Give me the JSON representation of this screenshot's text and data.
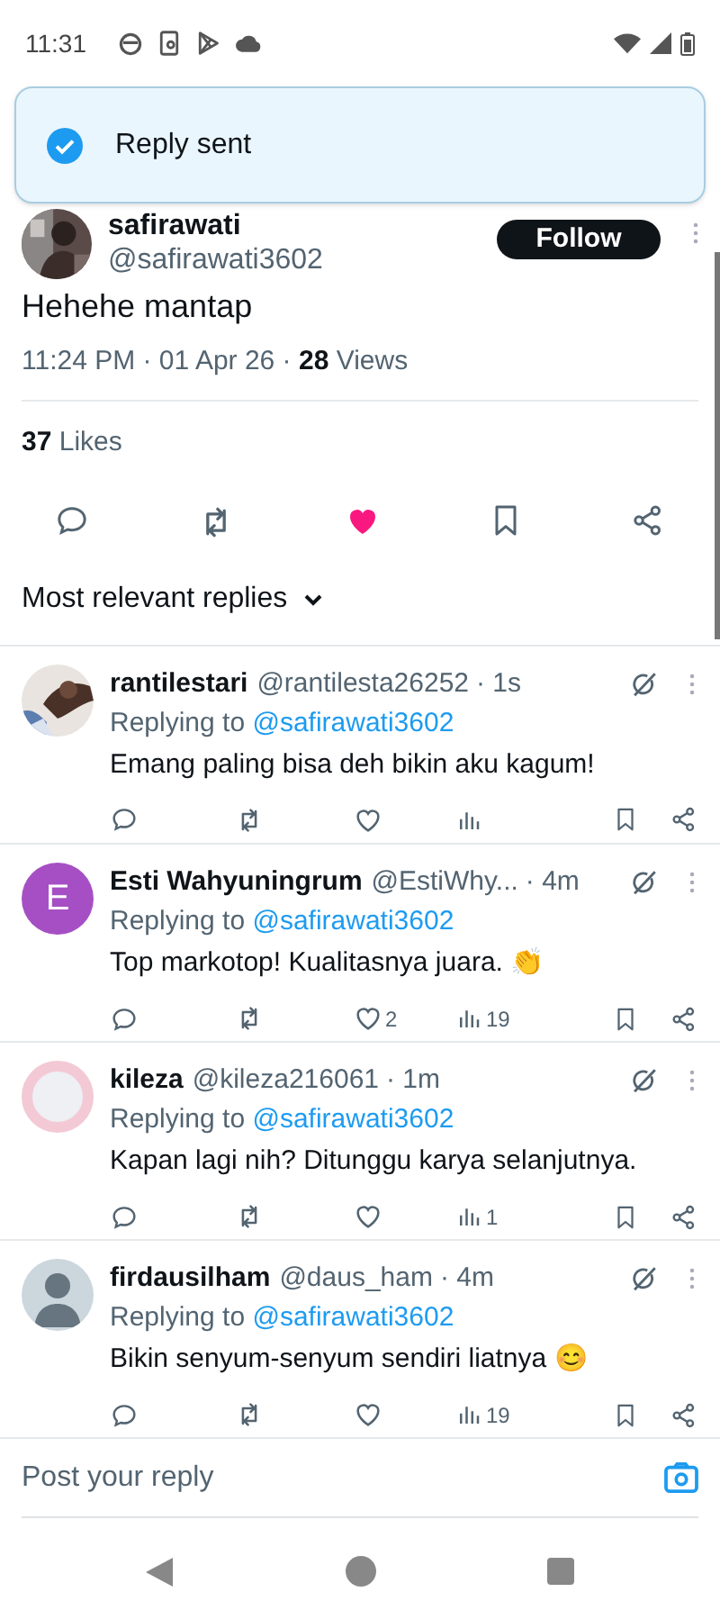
{
  "status_bar": {
    "time": "11:31"
  },
  "toast": {
    "text": "Reply sent"
  },
  "tweet": {
    "author": "safirawati",
    "handle": "@safirawati3602",
    "follow_label": "Follow",
    "text": "Hehehe mantap",
    "time": "11:24 PM · 01 Apr 26 · ",
    "views_count": "28",
    "views_label": " Views",
    "likes_count": "37",
    "likes_label": " Likes",
    "liked": true
  },
  "sort": {
    "label": "Most relevant replies"
  },
  "replies": [
    {
      "name": "rantilestari",
      "handle": "@rantilesta26252",
      "time": "· 1s",
      "replying_label": "Replying to ",
      "replying_to": "@safirawati3602",
      "text": "Emang paling bisa deh bikin aku kagum!",
      "liked": false
    },
    {
      "avatar": {
        "kind": "letter",
        "letter": "E",
        "color": "#a64fc4"
      },
      "name": "Esti Wahyuningrum",
      "handle": "@EstiWhy...",
      "time": "· 4m",
      "replying_label": "Replying to ",
      "replying_to": "@safirawati3602",
      "text": "Top markotop! Kualitasnya juara. 👏",
      "likes": "2",
      "views": "19",
      "liked": false
    },
    {
      "avatar": {
        "kind": "ring"
      },
      "name": "kileza",
      "handle": "@kileza216061",
      "time": "· 1m",
      "replying_label": "Replying to ",
      "replying_to": "@safirawati3602",
      "text": "Kapan lagi nih? Ditunggu karya selanjutnya.",
      "views": "1",
      "liked": false
    },
    {
      "avatar": {
        "kind": "default"
      },
      "name": "firdausilham",
      "handle": "@daus_ham",
      "time": "· 4m",
      "replying_label": "Replying to ",
      "replying_to": "@safirawati3602",
      "text": "Bikin senyum-senyum sendiri liatnya 😊",
      "views": "19",
      "liked": false
    }
  ],
  "composer": {
    "placeholder": "Post your reply"
  }
}
